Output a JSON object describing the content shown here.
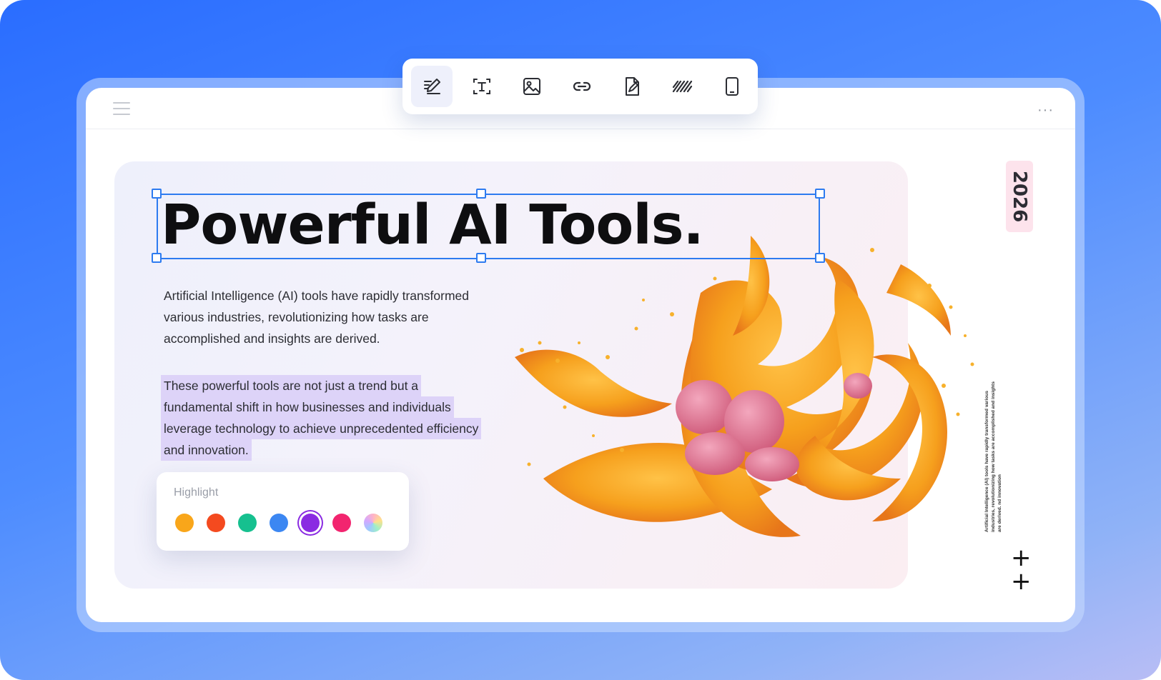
{
  "toolbar": {
    "tools": [
      {
        "name": "annotate",
        "icon": "pen-lines-icon",
        "active": true
      },
      {
        "name": "text",
        "icon": "text-box-icon",
        "active": false
      },
      {
        "name": "image",
        "icon": "image-icon",
        "active": false
      },
      {
        "name": "link",
        "icon": "link-icon",
        "active": false
      },
      {
        "name": "sign",
        "icon": "document-pen-icon",
        "active": false
      },
      {
        "name": "pattern",
        "icon": "stripes-icon",
        "active": false
      },
      {
        "name": "page",
        "icon": "tablet-icon",
        "active": false
      }
    ]
  },
  "window": {
    "menu_icon": "menu-icon",
    "more_icon": "more-icon",
    "more_label": "···"
  },
  "content": {
    "headline": "Powerful AI Tools.",
    "paragraph_lines": [
      "Artificial Intelligence (AI) tools have rapidly transformed",
      "various industries, revolutionizing how tasks are",
      "accomplished and insights are derived."
    ],
    "highlighted_lines": [
      "These powerful tools are not just a trend but a",
      "fundamental shift in how businesses and individuals",
      "leverage technology to achieve unprecedented efficiency",
      "and innovation."
    ]
  },
  "highlight_panel": {
    "title": "Highlight",
    "colors": [
      "#f9a61a",
      "#f44a1f",
      "#16c08f",
      "#3c87f2",
      "#8a2be2",
      "#f2256f",
      "conic"
    ],
    "selected_index": 4
  },
  "sidebar": {
    "year": "2026",
    "note": "Artificial Intelligence (AI) tools have rapidly transformed various industries, revolutionizing how tasks are accomplished and insights are derived. nd innovation",
    "plus_label": "+"
  },
  "colors": {
    "selection": "#2d7bf0",
    "highlight_bg": "#ddd3f8",
    "coral_main": "#f4a21c",
    "coral_bulb": "#e97a9c"
  }
}
